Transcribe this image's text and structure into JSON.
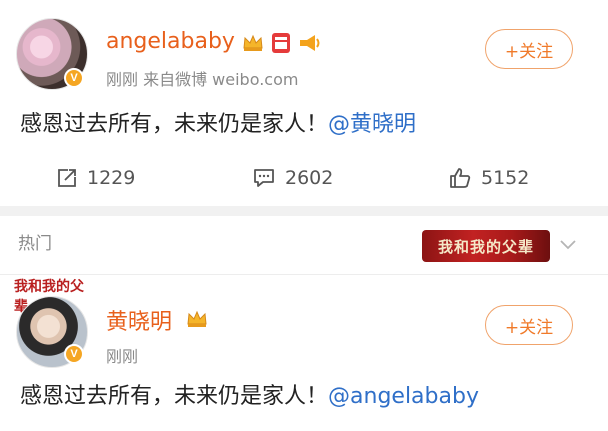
{
  "post1": {
    "username": "angelababy",
    "meta": "刚刚  来自微博 weibo.com",
    "follow_label": "+关注",
    "text_main": "感恩过去所有，未来仍是家人！",
    "text_mention": "@黄晓明",
    "repost_count": "1229",
    "comment_count": "2602",
    "like_count": "5152"
  },
  "section": {
    "hot_label": "热门",
    "banner_text": "我和我的父辈"
  },
  "post2": {
    "logo_text": "我和我的父辈",
    "username": "黄晓明",
    "meta": "刚刚",
    "follow_label": "+关注",
    "text_main": "感恩过去所有，未来仍是家人！",
    "text_mention": "@angelababy"
  },
  "colors": {
    "username": "#e8601c",
    "mention": "#2f6fc8",
    "follow_border": "#f0a36b",
    "follow_text": "#f07a2a",
    "meta": "#8a8a8a"
  },
  "icons": [
    "verified-badge-icon",
    "crown-icon",
    "red-seal-icon",
    "megaphone-icon",
    "repost-icon",
    "comment-icon",
    "like-icon",
    "chevron-down-icon"
  ]
}
